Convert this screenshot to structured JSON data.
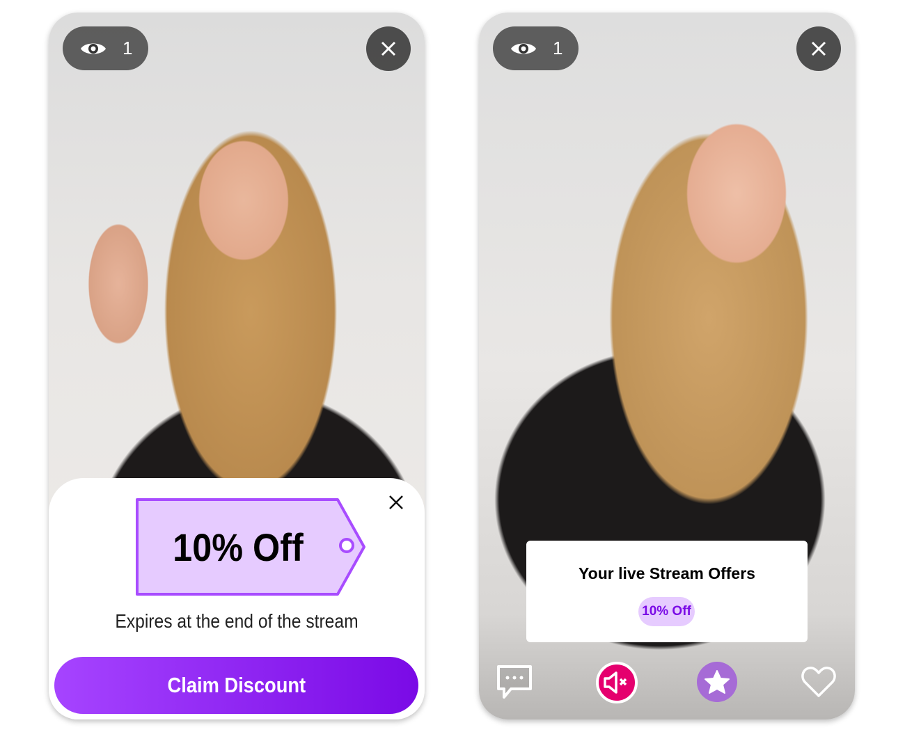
{
  "left_phone": {
    "viewer_count": "1",
    "discount_tag": "10% Off",
    "expires_text": "Expires at the end of the stream",
    "claim_button": "Claim Discount"
  },
  "right_phone": {
    "viewer_count": "1",
    "offers_title": "Your live Stream Offers",
    "offer_pill": "10% Off"
  },
  "colors": {
    "accent": "#7a0ae6",
    "tag_fill": "#e6cbff",
    "tag_border": "#a84cff",
    "mute": "#e5006e",
    "star": "#a66bd6"
  }
}
